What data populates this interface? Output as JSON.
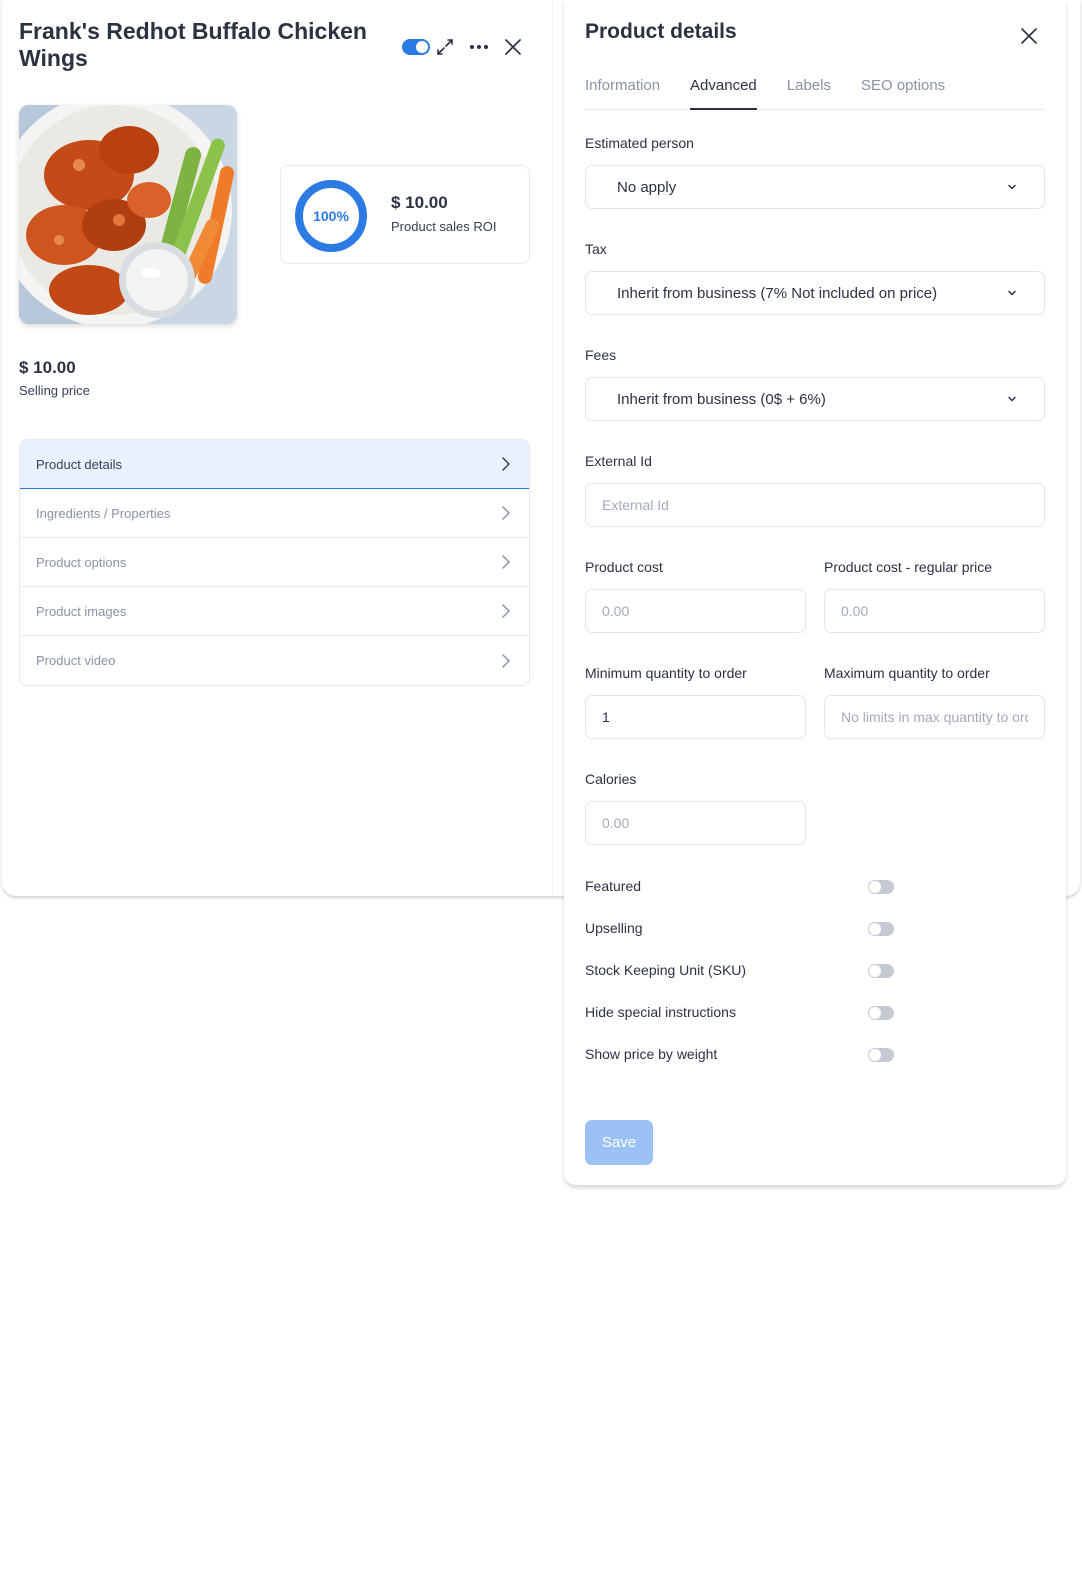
{
  "left_panel": {
    "product_title": "Frank's Redhot Buffalo Chicken Wings",
    "roi": {
      "percent_label": "100%",
      "percent_value": 100,
      "price": "$ 10.00",
      "label": "Product sales ROI"
    },
    "selling_price": "$ 10.00",
    "selling_price_label": "Selling price",
    "menu": [
      {
        "label": "Product details",
        "active": true
      },
      {
        "label": "Ingredients / Properties"
      },
      {
        "label": "Product options"
      },
      {
        "label": "Product images"
      },
      {
        "label": "Product video"
      }
    ],
    "icons": [
      "toggle-switch",
      "expand-icon",
      "more-icon",
      "close-icon"
    ]
  },
  "right_panel": {
    "title": "Product details",
    "tabs": [
      {
        "label": "Information"
      },
      {
        "label": "Advanced",
        "active": true
      },
      {
        "label": "Labels"
      },
      {
        "label": "SEO options"
      }
    ],
    "estimated_person": {
      "label": "Estimated person",
      "value": "No apply"
    },
    "tax": {
      "label": "Tax",
      "value": "Inherit from business (7% Not included on price)"
    },
    "fees": {
      "label": "Fees",
      "value": "Inherit from business (0$ + 6%)"
    },
    "external_id": {
      "label": "External Id",
      "placeholder": "External Id",
      "value": ""
    },
    "product_cost": {
      "label": "Product cost",
      "placeholder": "0.00"
    },
    "product_cost_regular": {
      "label": "Product cost - regular price",
      "placeholder": "0.00"
    },
    "min_qty": {
      "label": "Minimum quantity to order",
      "value": "1"
    },
    "max_qty": {
      "label": "Maximum quantity to order",
      "placeholder": "No limits in max quantity to order"
    },
    "calories": {
      "label": "Calories",
      "placeholder": "0.00"
    },
    "switches": [
      {
        "label": "Featured",
        "on": false
      },
      {
        "label": "Upselling",
        "on": false
      },
      {
        "label": "Stock Keeping Unit (SKU)",
        "on": false
      },
      {
        "label": "Hide special instructions",
        "on": false
      },
      {
        "label": "Show price by weight",
        "on": false
      }
    ],
    "save_label": "Save"
  },
  "colors": {
    "accent": "#2c7be5",
    "active_row": "#e8f1fd",
    "save_disabled": "#9cc2f5"
  }
}
